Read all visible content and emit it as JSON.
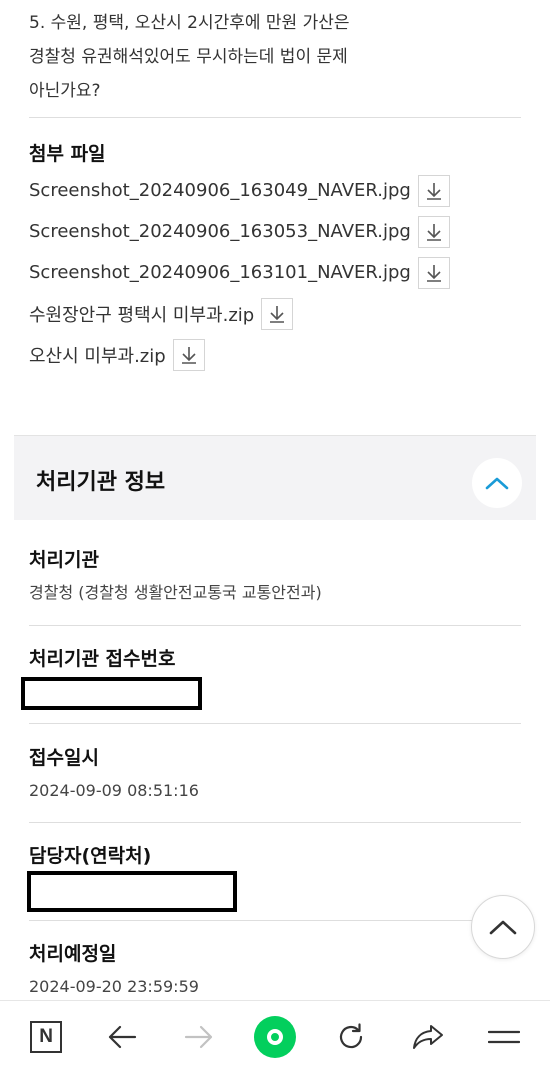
{
  "question": {
    "lines": [
      "5. 수원, 평택, 오산시 2시간후에 만원 가산은",
      "경찰청 유권해석있어도 무시하는데 법이 문제",
      "아닌가요?"
    ]
  },
  "attachments": {
    "title": "첨부 파일",
    "files": [
      {
        "name": "Screenshot_20240906_163049_NAVER.jpg"
      },
      {
        "name": "Screenshot_20240906_163053_NAVER.jpg"
      },
      {
        "name": "Screenshot_20240906_163101_NAVER.jpg"
      },
      {
        "name": "수원장안구 평택시 미부과.zip"
      },
      {
        "name": "오산시 미부과.zip"
      }
    ],
    "download_icon": "download-icon"
  },
  "section": {
    "title": "처리기관 정보",
    "collapse_icon": "chevron-up-icon"
  },
  "info": {
    "agency": {
      "label": "처리기관",
      "value": "경찰청 (경찰청 생활안전교통국 교통안전과)"
    },
    "receipt_no": {
      "label": "처리기관 접수번호",
      "value": ""
    },
    "received_at": {
      "label": "접수일시",
      "value": "2024-09-09 08:51:16"
    },
    "manager": {
      "label": "담당자(연락처)",
      "value": ""
    },
    "due_date": {
      "label": "처리예정일",
      "value": "2024-09-20 23:59:59"
    }
  },
  "nav": {
    "items": [
      "naver-home-icon",
      "back-arrow-icon",
      "forward-arrow-icon",
      "green-dot-icon",
      "refresh-icon",
      "share-icon",
      "menu-icon"
    ],
    "home_label": "N"
  },
  "colors": {
    "accent_green": "#03cf5d",
    "chevron_blue": "#1a9bd7",
    "section_bg": "#f3f3f5"
  }
}
